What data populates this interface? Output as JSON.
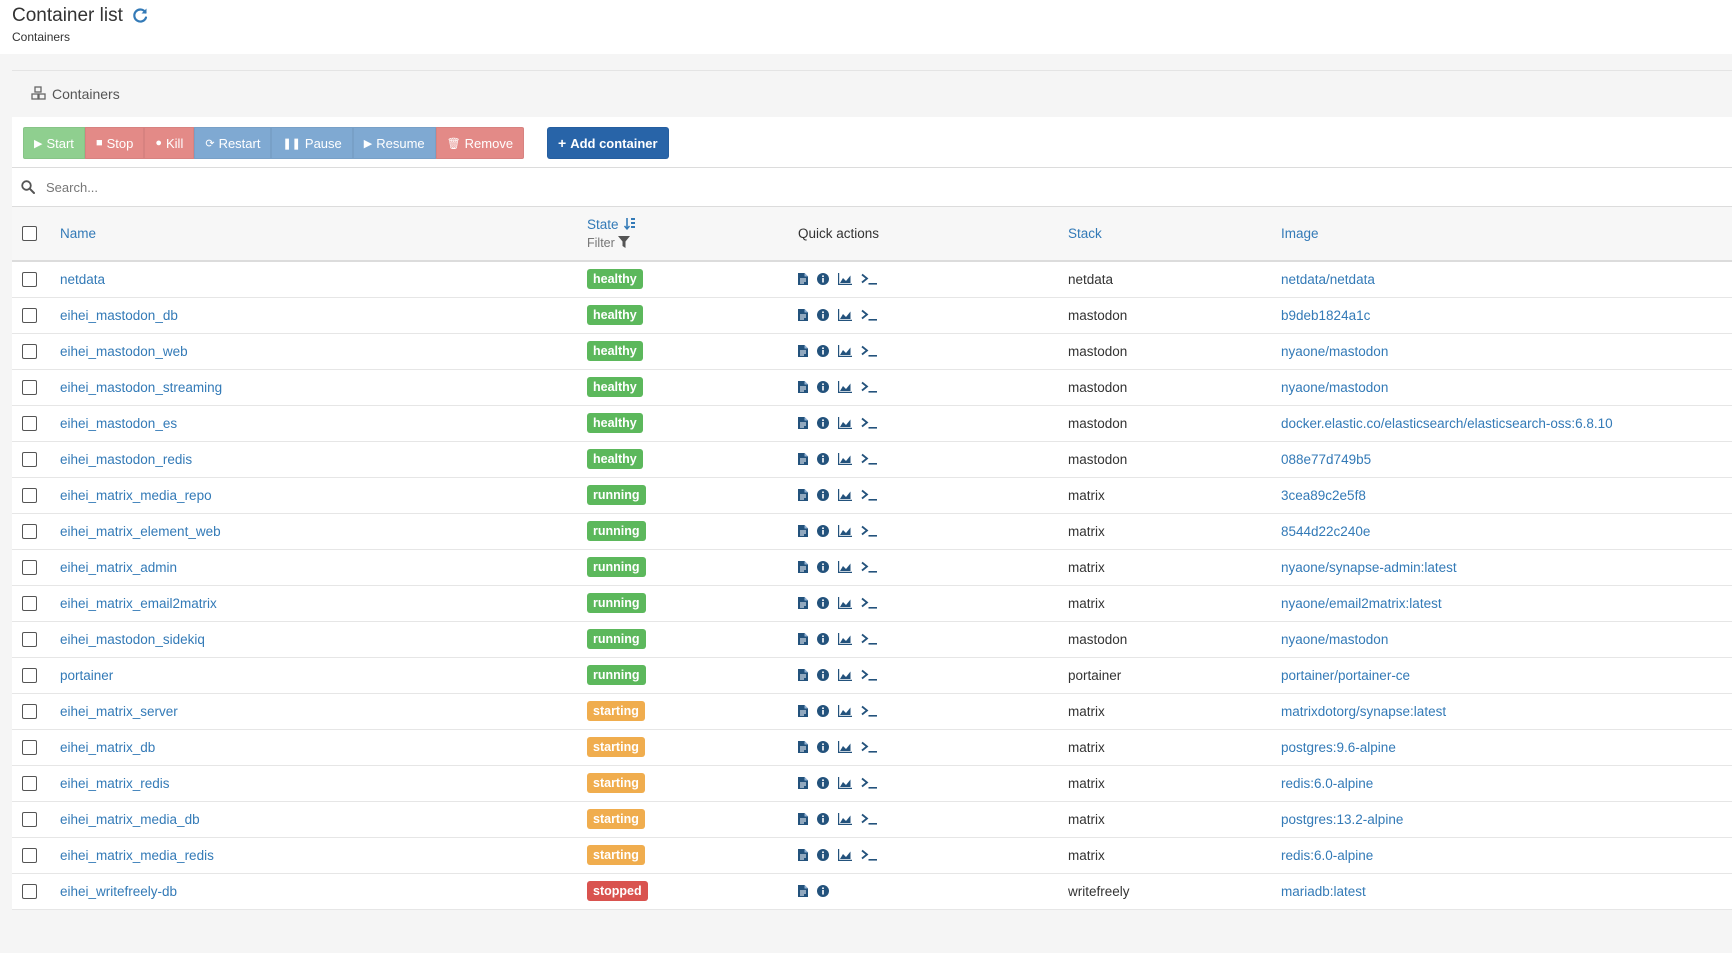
{
  "header": {
    "title": "Container list",
    "breadcrumb": "Containers"
  },
  "panel": {
    "title": "Containers"
  },
  "toolbar": {
    "start": "Start",
    "stop": "Stop",
    "kill": "Kill",
    "restart": "Restart",
    "pause": "Pause",
    "resume": "Resume",
    "remove": "Remove",
    "add": "Add container"
  },
  "search": {
    "placeholder": "Search..."
  },
  "columns": {
    "name": "Name",
    "state": "State",
    "filter": "Filter",
    "quick_actions": "Quick actions",
    "stack": "Stack",
    "image": "Image"
  },
  "colors": {
    "healthy": "#5cb85c",
    "running": "#5cb85c",
    "starting": "#f0ad4e",
    "stopped": "#d9534f",
    "link": "#337ab7",
    "primary": "#2864a8"
  },
  "icons": {
    "quick_actions": [
      "logs-icon",
      "inspect-icon",
      "stats-icon",
      "console-icon"
    ]
  },
  "containers": [
    {
      "name": "netdata",
      "state": "healthy",
      "stack": "netdata",
      "image": "netdata/netdata"
    },
    {
      "name": "eihei_mastodon_db",
      "state": "healthy",
      "stack": "mastodon",
      "image": "b9deb1824a1c"
    },
    {
      "name": "eihei_mastodon_web",
      "state": "healthy",
      "stack": "mastodon",
      "image": "nyaone/mastodon"
    },
    {
      "name": "eihei_mastodon_streaming",
      "state": "healthy",
      "stack": "mastodon",
      "image": "nyaone/mastodon"
    },
    {
      "name": "eihei_mastodon_es",
      "state": "healthy",
      "stack": "mastodon",
      "image": "docker.elastic.co/elasticsearch/elasticsearch-oss:6.8.10"
    },
    {
      "name": "eihei_mastodon_redis",
      "state": "healthy",
      "stack": "mastodon",
      "image": "088e77d749b5"
    },
    {
      "name": "eihei_matrix_media_repo",
      "state": "running",
      "stack": "matrix",
      "image": "3cea89c2e5f8"
    },
    {
      "name": "eihei_matrix_element_web",
      "state": "running",
      "stack": "matrix",
      "image": "8544d22c240e"
    },
    {
      "name": "eihei_matrix_admin",
      "state": "running",
      "stack": "matrix",
      "image": "nyaone/synapse-admin:latest"
    },
    {
      "name": "eihei_matrix_email2matrix",
      "state": "running",
      "stack": "matrix",
      "image": "nyaone/email2matrix:latest"
    },
    {
      "name": "eihei_mastodon_sidekiq",
      "state": "running",
      "stack": "mastodon",
      "image": "nyaone/mastodon"
    },
    {
      "name": "portainer",
      "state": "running",
      "stack": "portainer",
      "image": "portainer/portainer-ce"
    },
    {
      "name": "eihei_matrix_server",
      "state": "starting",
      "stack": "matrix",
      "image": "matrixdotorg/synapse:latest"
    },
    {
      "name": "eihei_matrix_db",
      "state": "starting",
      "stack": "matrix",
      "image": "postgres:9.6-alpine"
    },
    {
      "name": "eihei_matrix_redis",
      "state": "starting",
      "stack": "matrix",
      "image": "redis:6.0-alpine"
    },
    {
      "name": "eihei_matrix_media_db",
      "state": "starting",
      "stack": "matrix",
      "image": "postgres:13.2-alpine"
    },
    {
      "name": "eihei_matrix_media_redis",
      "state": "starting",
      "stack": "matrix",
      "image": "redis:6.0-alpine"
    },
    {
      "name": "eihei_writefreely-db",
      "state": "stopped",
      "stack": "writefreely",
      "image": "mariadb:latest"
    }
  ]
}
